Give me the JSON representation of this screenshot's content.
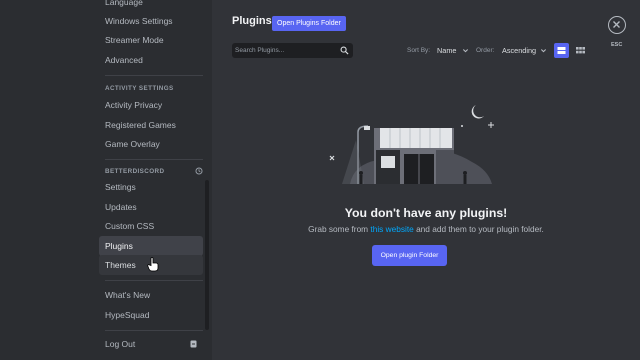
{
  "sidebar": {
    "items_top": [
      {
        "label": "Language",
        "name": "sidebar-item-language"
      },
      {
        "label": "Windows Settings",
        "name": "sidebar-item-windows-settings"
      },
      {
        "label": "Streamer Mode",
        "name": "sidebar-item-streamer-mode"
      },
      {
        "label": "Advanced",
        "name": "sidebar-item-advanced"
      }
    ],
    "activity_header": "ACTIVITY SETTINGS",
    "activity_items": [
      {
        "label": "Activity Privacy",
        "name": "sidebar-item-activity-privacy"
      },
      {
        "label": "Registered Games",
        "name": "sidebar-item-registered-games"
      },
      {
        "label": "Game Overlay",
        "name": "sidebar-item-game-overlay"
      }
    ],
    "betterdiscord_header": "BETTERDISCORD",
    "betterdiscord_items": [
      {
        "label": "Settings",
        "name": "sidebar-item-settings"
      },
      {
        "label": "Updates",
        "name": "sidebar-item-updates"
      },
      {
        "label": "Custom CSS",
        "name": "sidebar-item-custom-css"
      },
      {
        "label": "Plugins",
        "name": "sidebar-item-plugins"
      },
      {
        "label": "Themes",
        "name": "sidebar-item-themes"
      }
    ],
    "misc_items": [
      {
        "label": "What's New",
        "name": "sidebar-item-whats-new"
      },
      {
        "label": "HypeSquad",
        "name": "sidebar-item-hypesquad"
      }
    ],
    "logout_label": "Log Out",
    "selected": "Plugins",
    "hovered": "Themes"
  },
  "main": {
    "title": "Plugins",
    "open_folder_label": "Open Plugins Folder",
    "search_placeholder": "Search Plugins...",
    "sort_by_label": "Sort By:",
    "sort_by_value": "Name",
    "order_label": "Order:",
    "order_value": "Ascending",
    "view_mode": "list",
    "esc_label": "ESC",
    "empty": {
      "title": "You don't have any plugins!",
      "subtitle_before": "Grab some from ",
      "subtitle_link": "this website",
      "subtitle_after": " and add them to your plugin folder.",
      "button_label": "Open plugin Folder"
    }
  },
  "colors": {
    "accent": "#5865f2",
    "link": "#00a8fc",
    "background": "#313338",
    "sidebar": "#2b2d31"
  },
  "icons": [
    "history-icon",
    "search-icon",
    "chevron-down-icon",
    "list-view-icon",
    "grid-view-icon",
    "close-icon",
    "logout-icon",
    "cursor-icon"
  ]
}
